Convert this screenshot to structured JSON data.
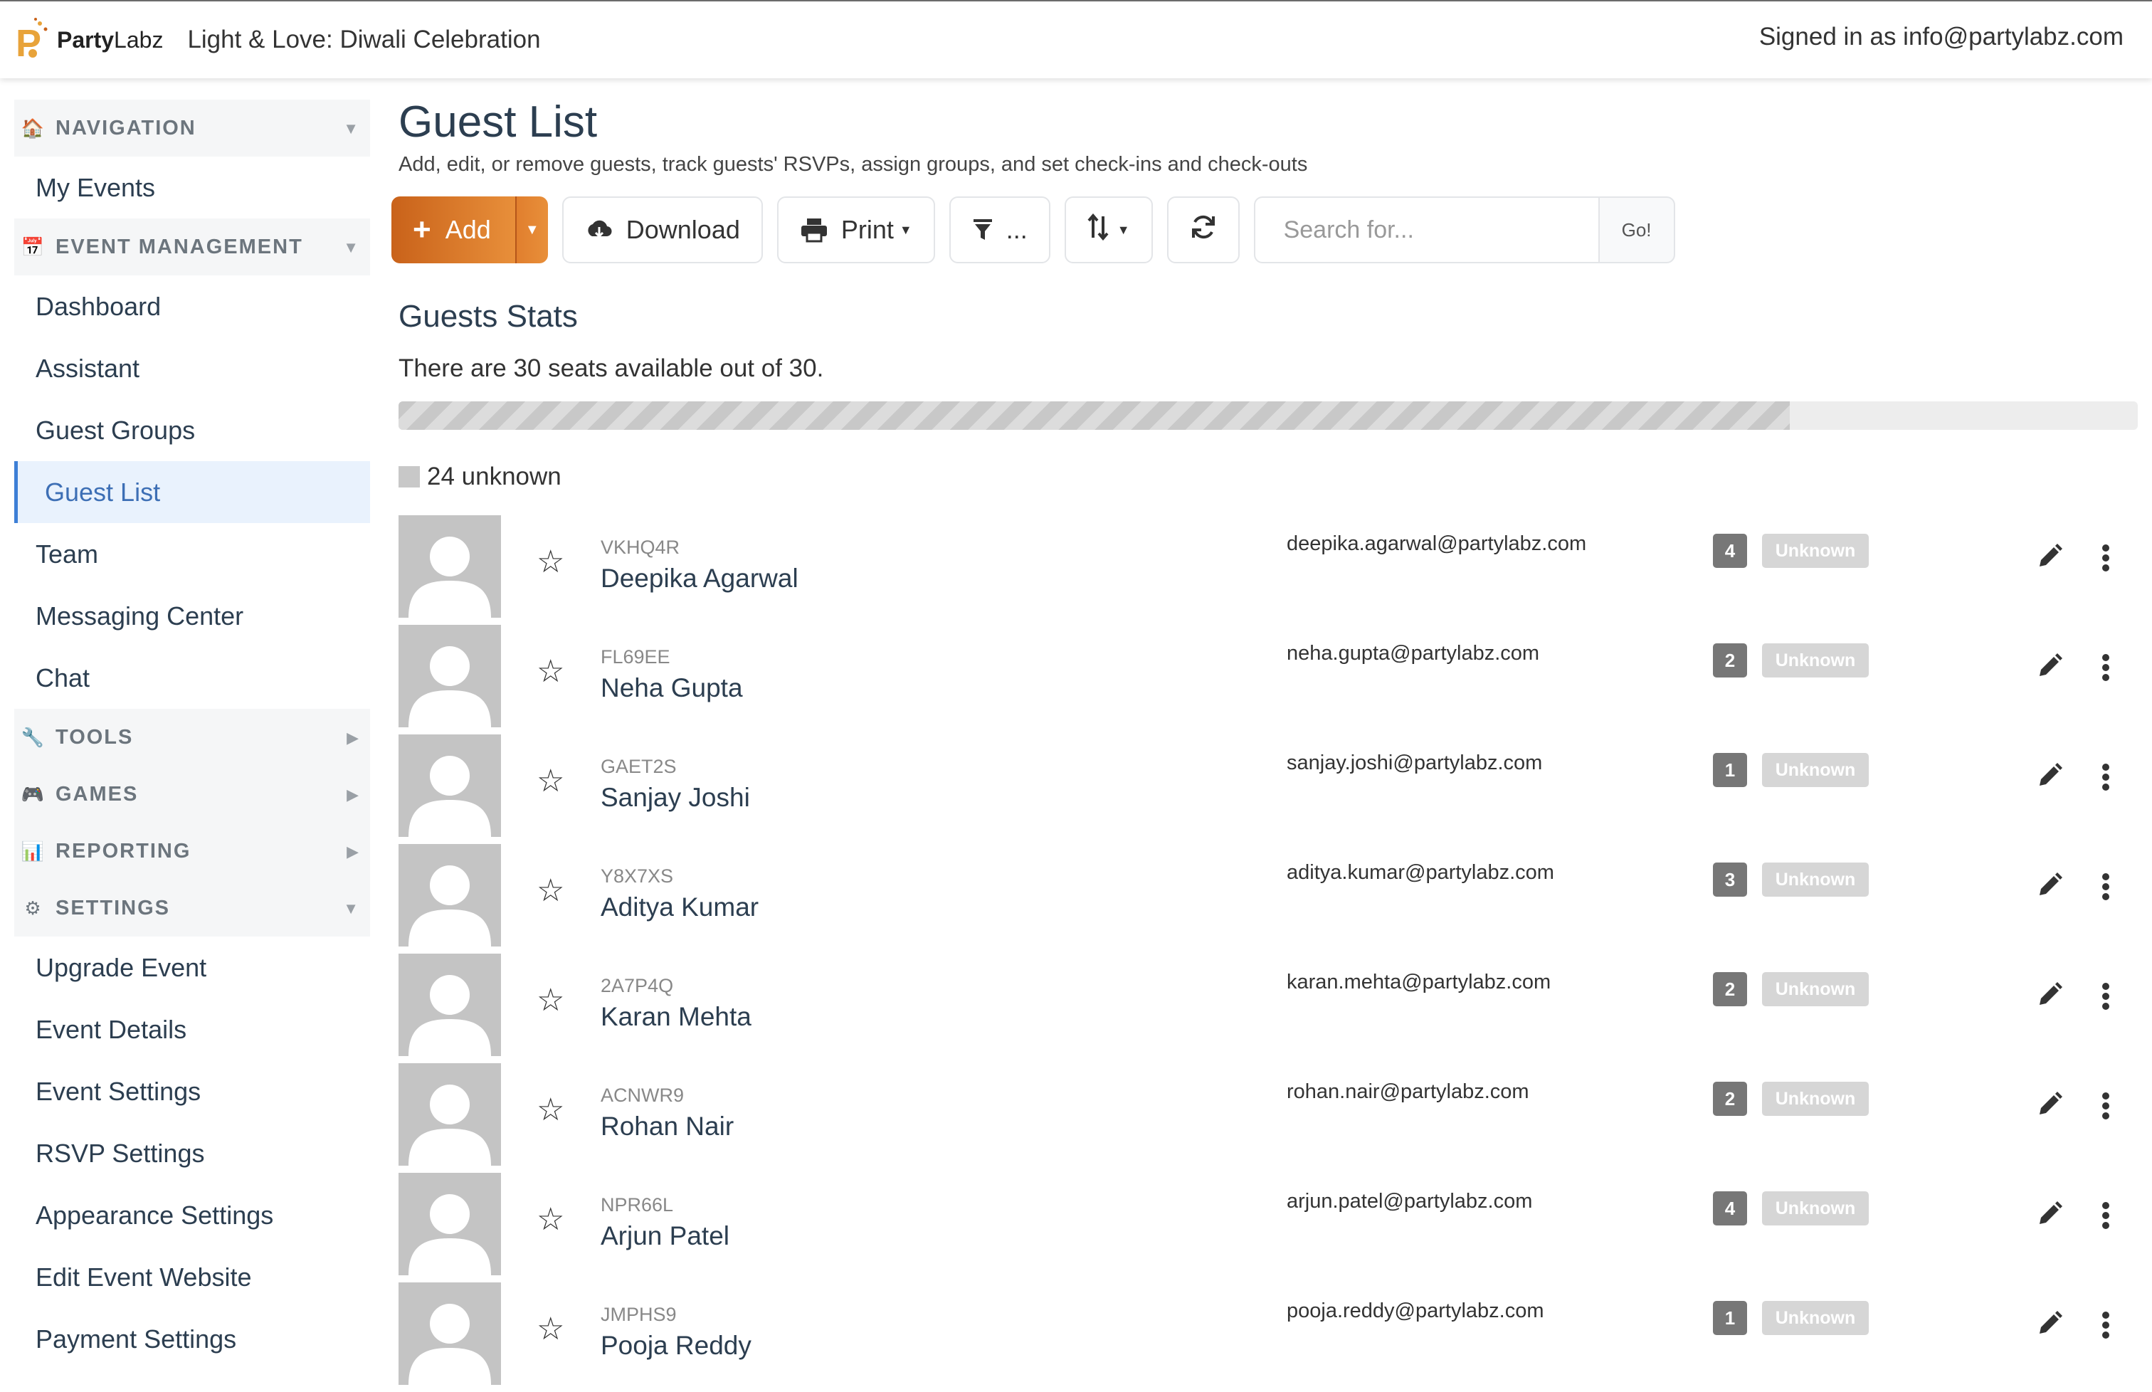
{
  "header": {
    "logo_brand_bold": "Party",
    "logo_brand_light": "Labz",
    "event_name": "Light & Love: Diwali Celebration",
    "signed_in": "Signed in as info@partylabz.com"
  },
  "sidebar": {
    "sections": [
      {
        "title": "NAVIGATION",
        "icon": "home-icon",
        "expanded": true,
        "items": [
          "My Events"
        ]
      },
      {
        "title": "EVENT MANAGEMENT",
        "icon": "calendar-icon",
        "expanded": true,
        "items": [
          "Dashboard",
          "Assistant",
          "Guest Groups",
          "Guest List",
          "Team",
          "Messaging Center",
          "Chat"
        ]
      },
      {
        "title": "TOOLS",
        "icon": "wrench-icon",
        "expanded": false,
        "items": []
      },
      {
        "title": "GAMES",
        "icon": "gamepad-icon",
        "expanded": false,
        "items": []
      },
      {
        "title": "REPORTING",
        "icon": "bar-chart-icon",
        "expanded": false,
        "items": []
      },
      {
        "title": "SETTINGS",
        "icon": "gear-icon",
        "expanded": true,
        "items": [
          "Upgrade Event",
          "Event Details",
          "Event Settings",
          "RSVP Settings",
          "Appearance Settings",
          "Edit Event Website",
          "Payment Settings"
        ]
      }
    ],
    "active_item": "Guest List"
  },
  "page": {
    "title": "Guest List",
    "subtitle": "Add, edit, or remove guests, track guests' RSVPs, assign groups, and set check-ins and check-outs"
  },
  "toolbar": {
    "add_label": "Add",
    "download_label": "Download",
    "print_label": "Print",
    "filter_label": "...",
    "search_placeholder": "Search for...",
    "go_label": "Go!"
  },
  "stats": {
    "title": "Guests Stats",
    "text": "There are 30 seats available out of 30.",
    "progress_fraction": 0.8,
    "legend": "24 unknown"
  },
  "guests": [
    {
      "code": "VKHQ4R",
      "name": "Deepika Agarwal",
      "email": "deepika.agarwal@partylabz.com",
      "count": "4",
      "status": "Unknown"
    },
    {
      "code": "FL69EE",
      "name": "Neha Gupta",
      "email": "neha.gupta@partylabz.com",
      "count": "2",
      "status": "Unknown"
    },
    {
      "code": "GAET2S",
      "name": "Sanjay Joshi",
      "email": "sanjay.joshi@partylabz.com",
      "count": "1",
      "status": "Unknown"
    },
    {
      "code": "Y8X7XS",
      "name": "Aditya Kumar",
      "email": "aditya.kumar@partylabz.com",
      "count": "3",
      "status": "Unknown"
    },
    {
      "code": "2A7P4Q",
      "name": "Karan Mehta",
      "email": "karan.mehta@partylabz.com",
      "count": "2",
      "status": "Unknown"
    },
    {
      "code": "ACNWR9",
      "name": "Rohan Nair",
      "email": "rohan.nair@partylabz.com",
      "count": "2",
      "status": "Unknown"
    },
    {
      "code": "NPR66L",
      "name": "Arjun Patel",
      "email": "arjun.patel@partylabz.com",
      "count": "4",
      "status": "Unknown"
    },
    {
      "code": "JMPHS9",
      "name": "Pooja Reddy",
      "email": "pooja.reddy@partylabz.com",
      "count": "1",
      "status": "Unknown"
    }
  ]
}
